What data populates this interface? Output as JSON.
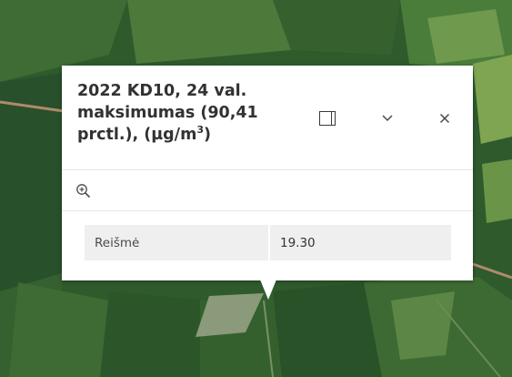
{
  "popup": {
    "title": "2022 KD10, 24 val. maksimumas (90,41 prctl.), (µg/m³)",
    "title_parts": {
      "main": "2022 KD10, 24 val. maksimumas (90,41 prctl.), (µg/m",
      "superscript": "3",
      "suffix": ")"
    },
    "buttons": {
      "dock_icon": "dock-panel-icon",
      "collapse_icon": "chevron-down-icon",
      "close_icon": "close-icon"
    },
    "actions": {
      "zoom_icon": "zoom-in-icon"
    },
    "attributes": [
      {
        "field": "Reišmė",
        "value": "19.30"
      }
    ]
  },
  "colors": {
    "popup_background": "#ffffff",
    "table_background": "#efefef",
    "title_text": "#323232"
  }
}
